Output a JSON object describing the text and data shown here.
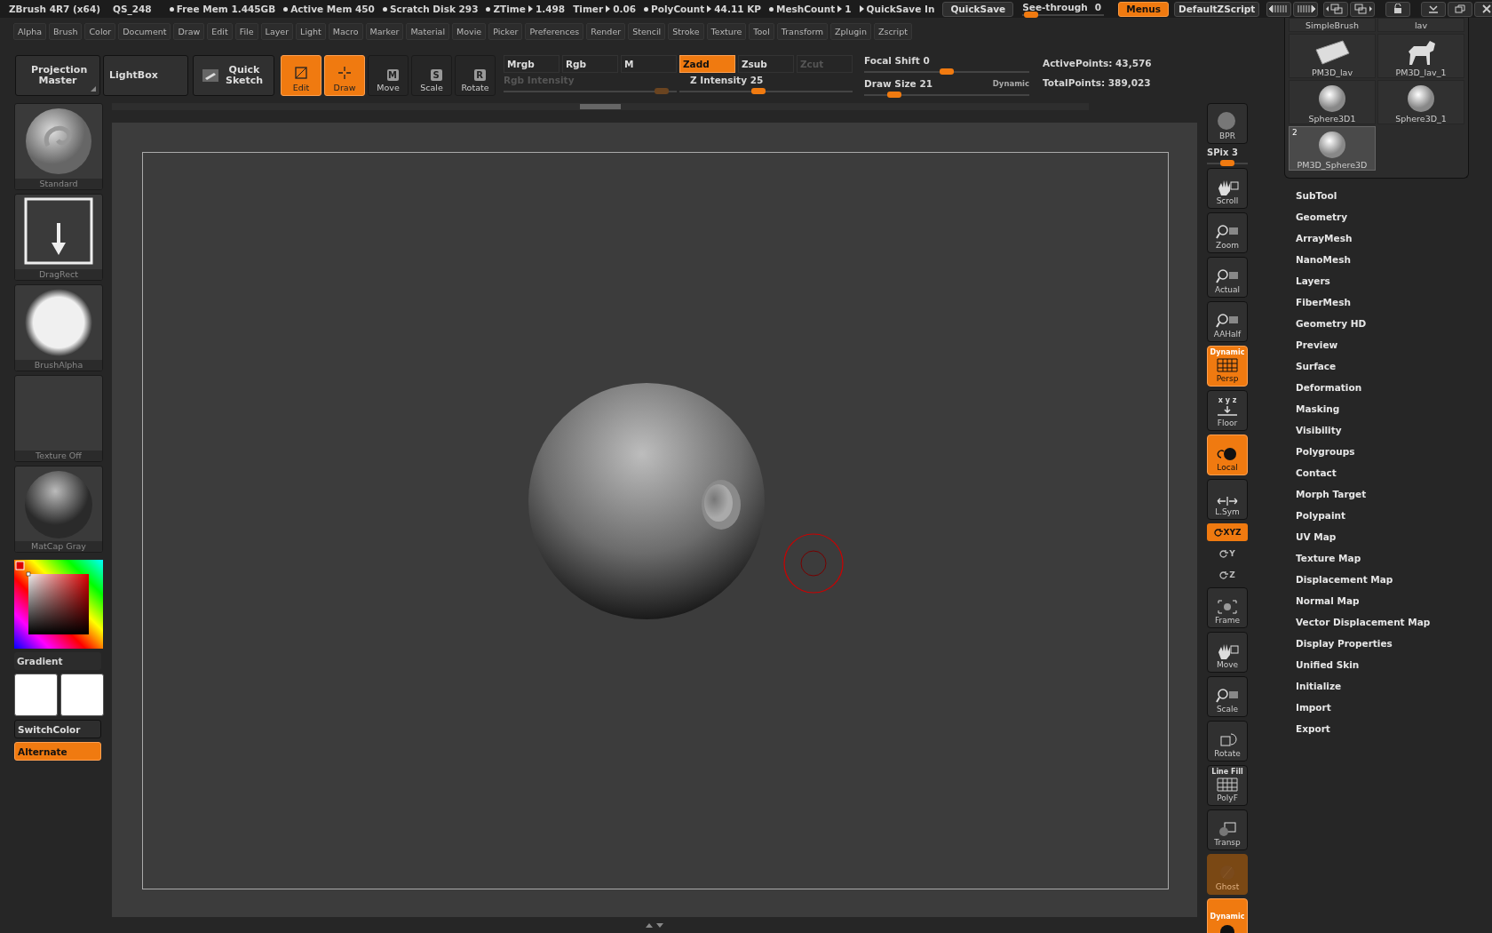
{
  "title_bar": {
    "app": "ZBrush 4R7 (x64)",
    "file": "QS_248",
    "stats": [
      {
        "dot": true,
        "label": "Free Mem 1.445GB"
      },
      {
        "dot": true,
        "label": "Active Mem 450"
      },
      {
        "dot": true,
        "label": "Scratch Disk 293"
      },
      {
        "dot": true,
        "label": "ZTime",
        "value": "1.498"
      },
      {
        "dot": false,
        "label": "Timer",
        "value": "0.06"
      },
      {
        "dot": true,
        "label": "PolyCount",
        "value": "44.11 KP"
      },
      {
        "dot": true,
        "label": "MeshCount",
        "value": "1"
      },
      {
        "dot": false,
        "value": "QuickSave In"
      }
    ],
    "quicksave": "QuickSave",
    "see_through": {
      "label": "See-through",
      "value": "0"
    },
    "menus_button": {
      "label": "Menus",
      "on": true
    },
    "script_button": "DefaultZScript"
  },
  "menu_bar": [
    "Alpha",
    "Brush",
    "Color",
    "Document",
    "Draw",
    "Edit",
    "File",
    "Layer",
    "Light",
    "Macro",
    "Marker",
    "Material",
    "Movie",
    "Picker",
    "Preferences",
    "Render",
    "Stencil",
    "Stroke",
    "Texture",
    "Tool",
    "Transform",
    "Zplugin",
    "Zscript"
  ],
  "toolbar": {
    "projection_master": "Projection Master",
    "lightbox": "LightBox",
    "quick_sketch": "Quick Sketch",
    "transform_buttons": [
      {
        "label": "Edit",
        "on": true
      },
      {
        "label": "Draw",
        "on": true
      },
      {
        "label": "Move",
        "glyph": "M",
        "on": false
      },
      {
        "label": "Scale",
        "glyph": "S",
        "on": false
      },
      {
        "label": "Rotate",
        "glyph": "R",
        "on": false
      }
    ],
    "modes": [
      {
        "label": "Mrgb",
        "selected": false,
        "disabled": false
      },
      {
        "label": "Rgb",
        "selected": false,
        "disabled": false
      },
      {
        "label": "M",
        "selected": false,
        "disabled": false
      },
      {
        "label": "Zadd",
        "selected": true,
        "disabled": false
      },
      {
        "label": "Zsub",
        "selected": false,
        "disabled": false
      },
      {
        "label": "Zcut",
        "selected": false,
        "disabled": true
      }
    ],
    "rgb_intensity": {
      "label": "Rgb Intensity",
      "disabled": true,
      "level": 0.95
    },
    "z_intensity": {
      "label": "Z Intensity",
      "value": "25",
      "disabled": false,
      "level": 0.45
    },
    "focal_shift": {
      "label": "Focal Shift",
      "value": "0",
      "level": 0.5
    },
    "draw_size": {
      "label": "Draw Size",
      "value": "21",
      "level": 0.15
    },
    "dynamic": "Dynamic",
    "active_points": {
      "label": "ActivePoints:",
      "value": "43,576"
    },
    "total_points": {
      "label": "TotalPoints:",
      "value": "389,023"
    }
  },
  "left_panel": {
    "thumbs": [
      {
        "label": "Standard",
        "kind": "brush"
      },
      {
        "label": "DragRect",
        "kind": "stroke"
      },
      {
        "label": "BrushAlpha",
        "kind": "alpha"
      },
      {
        "label": "Texture Off",
        "kind": "empty"
      },
      {
        "label": "MatCap Gray",
        "kind": "material"
      }
    ],
    "gradient": "Gradient",
    "switch_color": "SwitchColor",
    "alternate": {
      "label": "Alternate",
      "on": true
    }
  },
  "shelf": [
    {
      "kind": "button",
      "label": "BPR",
      "on": false,
      "disabled": false
    },
    {
      "kind": "slider",
      "label": "SPix 3",
      "level": 0.5
    },
    {
      "kind": "button",
      "label": "Scroll",
      "on": false,
      "disabled": false
    },
    {
      "kind": "button",
      "label": "Zoom",
      "on": false,
      "disabled": false
    },
    {
      "kind": "button",
      "label": "Actual",
      "on": false,
      "disabled": false
    },
    {
      "kind": "button",
      "label": "AAHalf",
      "on": false,
      "disabled": false
    },
    {
      "kind": "button",
      "top": "Dynamic",
      "label": "Persp",
      "on": true,
      "disabled": false
    },
    {
      "kind": "button",
      "top": "x y z",
      "label": "Floor",
      "on": false,
      "disabled": false
    },
    {
      "kind": "button",
      "label": "Local",
      "on": true,
      "disabled": false
    },
    {
      "kind": "button",
      "label": "L.Sym",
      "on": false,
      "disabled": false
    },
    {
      "kind": "small",
      "label": "XYZ",
      "on": true
    },
    {
      "kind": "small",
      "label": "Y",
      "on": false
    },
    {
      "kind": "small",
      "label": "Z",
      "on": false
    },
    {
      "kind": "button",
      "label": "Frame",
      "on": false,
      "disabled": false
    },
    {
      "kind": "button",
      "label": "Move",
      "on": false,
      "disabled": false
    },
    {
      "kind": "button",
      "label": "Scale",
      "on": false,
      "disabled": false
    },
    {
      "kind": "button",
      "label": "Rotate",
      "on": false,
      "disabled": false
    },
    {
      "kind": "button",
      "top": "Line Fill",
      "label": "PolyF",
      "on": false,
      "disabled": false
    },
    {
      "kind": "button",
      "label": "Transp",
      "on": false,
      "disabled": false
    },
    {
      "kind": "button",
      "label": "Ghost",
      "on": true,
      "disabled": true
    },
    {
      "kind": "button",
      "top": "Dynamic",
      "on": true,
      "disabled": false
    }
  ],
  "tool_palette": {
    "tools": [
      {
        "label": "SimpleBrush",
        "kind": "cut",
        "selected": false
      },
      {
        "label": "lav",
        "kind": "cut",
        "selected": false
      },
      {
        "label": "PM3D_lav",
        "kind": "block",
        "selected": false
      },
      {
        "label": "PM3D_lav_1",
        "kind": "figure",
        "selected": false
      },
      {
        "label": "Sphere3D1",
        "kind": "sphere",
        "selected": false
      },
      {
        "label": "Sphere3D_1",
        "kind": "sphere",
        "selected": false
      },
      {
        "label": "PM3D_Sphere3D",
        "kind": "sphere",
        "selected": true,
        "badge": "2"
      }
    ],
    "menu": [
      "SubTool",
      "Geometry",
      "ArrayMesh",
      "NanoMesh",
      "Layers",
      "FiberMesh",
      "Geometry HD",
      "Preview",
      "Surface",
      "Deformation",
      "Masking",
      "Visibility",
      "Polygroups",
      "Contact",
      "Morph Target",
      "Polypaint",
      "UV Map",
      "Texture Map",
      "Displacement Map",
      "Normal Map",
      "Vector Displacement Map",
      "Display Properties",
      "Unified Skin",
      "Initialize",
      "Import",
      "Export"
    ]
  }
}
